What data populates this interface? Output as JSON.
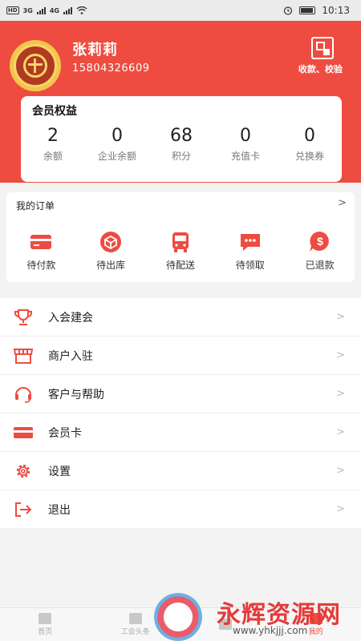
{
  "status_bar": {
    "left_badges": [
      "HD",
      "3G",
      "4G"
    ],
    "time": "10:13"
  },
  "profile": {
    "name": "张莉莉",
    "phone": "15804326609",
    "scan_label": "收款、校验"
  },
  "benefits": {
    "title": "会员权益",
    "stats": [
      {
        "value": "2",
        "label": "余额"
      },
      {
        "value": "0",
        "label": "企业余额"
      },
      {
        "value": "68",
        "label": "积分"
      },
      {
        "value": "0",
        "label": "充值卡"
      },
      {
        "value": "0",
        "label": "兑换券"
      }
    ]
  },
  "orders": {
    "title": "我的订单",
    "arrow": ">",
    "items": [
      {
        "label": "待付款",
        "icon": "card-icon"
      },
      {
        "label": "待出库",
        "icon": "box-icon"
      },
      {
        "label": "待配送",
        "icon": "bus-icon"
      },
      {
        "label": "待领取",
        "icon": "chat-icon"
      },
      {
        "label": "已退款",
        "icon": "dollar-icon"
      }
    ]
  },
  "menu": {
    "chevron": ">",
    "items": [
      {
        "label": "入会建会",
        "icon": "trophy-icon"
      },
      {
        "label": "商户入驻",
        "icon": "store-icon"
      },
      {
        "label": "客户与帮助",
        "icon": "headset-icon"
      },
      {
        "label": "会员卡",
        "icon": "card-icon"
      },
      {
        "label": "设置",
        "icon": "gear-icon"
      },
      {
        "label": "退出",
        "icon": "logout-icon"
      }
    ]
  },
  "tabbar": {
    "tabs": [
      {
        "label": "首页",
        "icon": "home-icon"
      },
      {
        "label": "工会头条",
        "icon": "news-icon"
      },
      {
        "label": "",
        "icon": "mall-icon"
      },
      {
        "label": "我的",
        "icon": "user-icon"
      }
    ]
  },
  "watermark": {
    "text": "永辉资源网",
    "url": "www.yhkjjj.com"
  },
  "colors": {
    "brand": "#ee4c40",
    "background": "#f3f3f3"
  }
}
